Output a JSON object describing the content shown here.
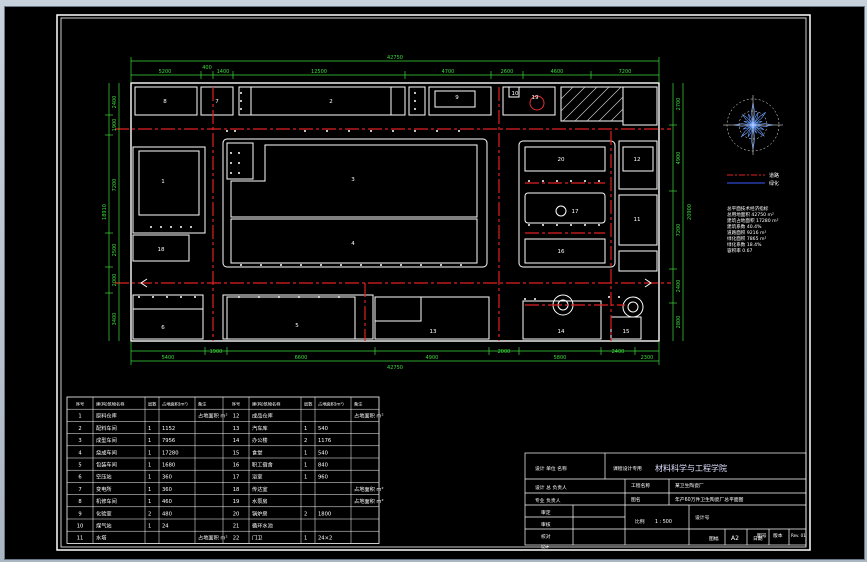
{
  "drawing": {
    "overall_dims": [
      "42750",
      "42750"
    ],
    "top_dims": [
      "5200",
      "400",
      "1400",
      "12500",
      "4700",
      "2600",
      "4600",
      "7200"
    ],
    "bottom_dims": [
      "5400",
      "1900",
      "6600",
      "4900",
      "2000",
      "5800",
      "2400",
      "2300"
    ],
    "left_dims": [
      "2400",
      "1900",
      "7200",
      "2500",
      "2000",
      "3400"
    ],
    "left_total": "18910",
    "right_dims": [
      "2700",
      "4900",
      "7200",
      "2400",
      "2800"
    ],
    "right_total": "20900",
    "building_numbers": [
      "1",
      "2",
      "3",
      "4",
      "5",
      "6",
      "7",
      "8",
      "9",
      "10",
      "11",
      "12",
      "13",
      "14",
      "15",
      "16",
      "17",
      "18",
      "19",
      "20"
    ]
  },
  "legend": {
    "line1_label": "道路",
    "line2_label": "绿化"
  },
  "econ_notes": [
    "总平面技术经济指标",
    "总用地面积  42750 m²",
    "建筑占地面积  17280 m²",
    "建筑系数  40.4%",
    "道路面积  9216 m²",
    "绿化面积  7865 m²",
    "绿化系数  18.4%",
    "容积率  0.67"
  ],
  "building_table": {
    "headers": [
      "序号",
      "建(构)筑物名称",
      "层数",
      "占地面积(m²)",
      "备注",
      "序号",
      "建(构)筑物名称",
      "层数",
      "占地面积(m²)",
      "备注"
    ],
    "rows": [
      [
        "1",
        "原料仓库",
        "",
        "",
        "占地面积 m²",
        "12",
        "成品仓库",
        "",
        "",
        "占地面积 m²"
      ],
      [
        "2",
        "配料车间",
        "1",
        "1152",
        "",
        "13",
        "汽车库",
        "1",
        "540",
        ""
      ],
      [
        "3",
        "成型车间",
        "1",
        "7956",
        "",
        "14",
        "办公楼",
        "2",
        "1176",
        ""
      ],
      [
        "4",
        "烧成车间",
        "1",
        "17280",
        "",
        "15",
        "食堂",
        "1",
        "540",
        ""
      ],
      [
        "5",
        "包装车间",
        "1",
        "1680",
        "",
        "16",
        "职工宿舍",
        "1",
        "840",
        ""
      ],
      [
        "6",
        "空压站",
        "1",
        "360",
        "",
        "17",
        "浴室",
        "1",
        "960",
        ""
      ],
      [
        "7",
        "变电所",
        "1",
        "360",
        "",
        "18",
        "传达室",
        "",
        "",
        "占地面积 m²"
      ],
      [
        "8",
        "机修车间",
        "1",
        "460",
        "",
        "19",
        "水泵房",
        "",
        "",
        "占地面积 m²"
      ],
      [
        "9",
        "化验室",
        "2",
        "480",
        "",
        "20",
        "锅炉房",
        "2",
        "1800",
        ""
      ],
      [
        "10",
        "煤气站",
        "1",
        "24",
        "",
        "21",
        "循环水池",
        "",
        "",
        ""
      ],
      [
        "11",
        "水塔",
        "",
        "",
        "占地面积 m²",
        "22",
        "门卫",
        "1",
        "24×2",
        ""
      ]
    ]
  },
  "title_block": {
    "dept_label": "设计 单位 名称",
    "dept_value": "课程设计专用",
    "school": "材料科学与工程学院",
    "project_label": "设计 总 负责人",
    "project_name": "工程名称",
    "project_value": "某卫生陶瓷厂",
    "reviewer_label": "专业 负责人",
    "drawing_label": "图名",
    "drawing_value": "年产60万件卫生陶瓷厂总平面图",
    "row_labels": [
      "审定",
      "审核",
      "校对",
      "设计"
    ],
    "scale_label": "比例",
    "scale_value": "1 : 500",
    "design_no_label": "设计号",
    "sheet_label": "图号",
    "size_label": "图幅",
    "size_value": "A2",
    "date_label": "日期",
    "rev_label": "Rev. 01",
    "edit_label": "版本"
  }
}
